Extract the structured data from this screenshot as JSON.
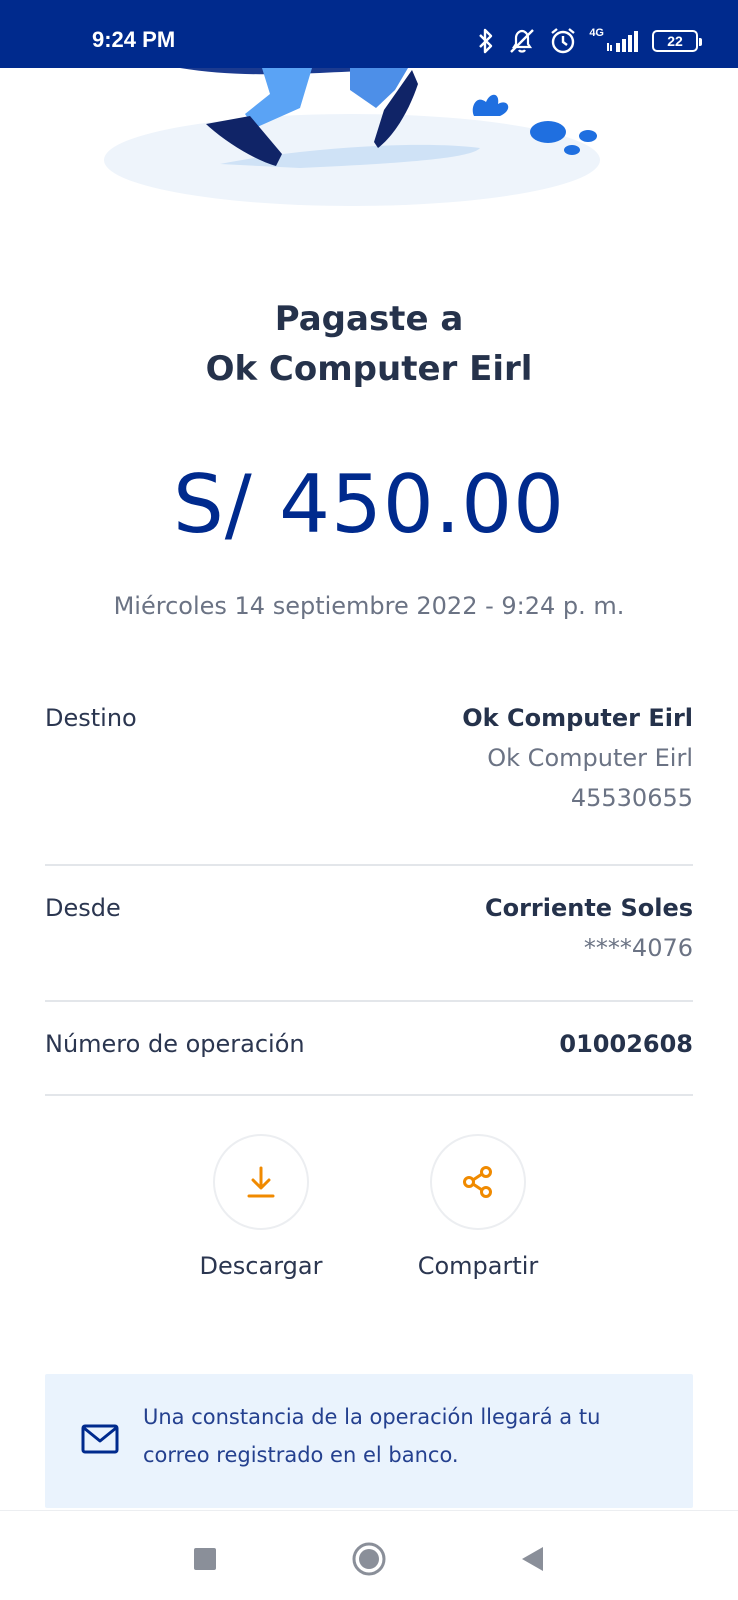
{
  "status_bar": {
    "time": "9:24 PM",
    "network": "4G",
    "battery": "22"
  },
  "receipt": {
    "title_line1": "Pagaste a",
    "title_line2": "Ok Computer Eirl",
    "amount": "S/ 450.00",
    "date": "Miércoles 14 septiembre 2022 - 9:24 p. m."
  },
  "details": {
    "destino": {
      "label": "Destino",
      "name": "Ok Computer Eirl",
      "alias": "Ok Computer Eirl",
      "number": "45530655"
    },
    "desde": {
      "label": "Desde",
      "account": "Corriente Soles",
      "masked": "****4076"
    },
    "operacion": {
      "label": "Número de operación",
      "value": "01002608"
    }
  },
  "actions": {
    "download_label": "Descargar",
    "share_label": "Compartir"
  },
  "notice": {
    "text": "Una constancia de la operación llegará a tu correo registrado en el banco."
  },
  "colors": {
    "brand_blue": "#002a8d",
    "accent_orange": "#f08a00",
    "notice_bg": "#eaf3fd"
  },
  "icons": {
    "download": "download-icon",
    "share": "share-icon",
    "mail": "mail-icon"
  }
}
